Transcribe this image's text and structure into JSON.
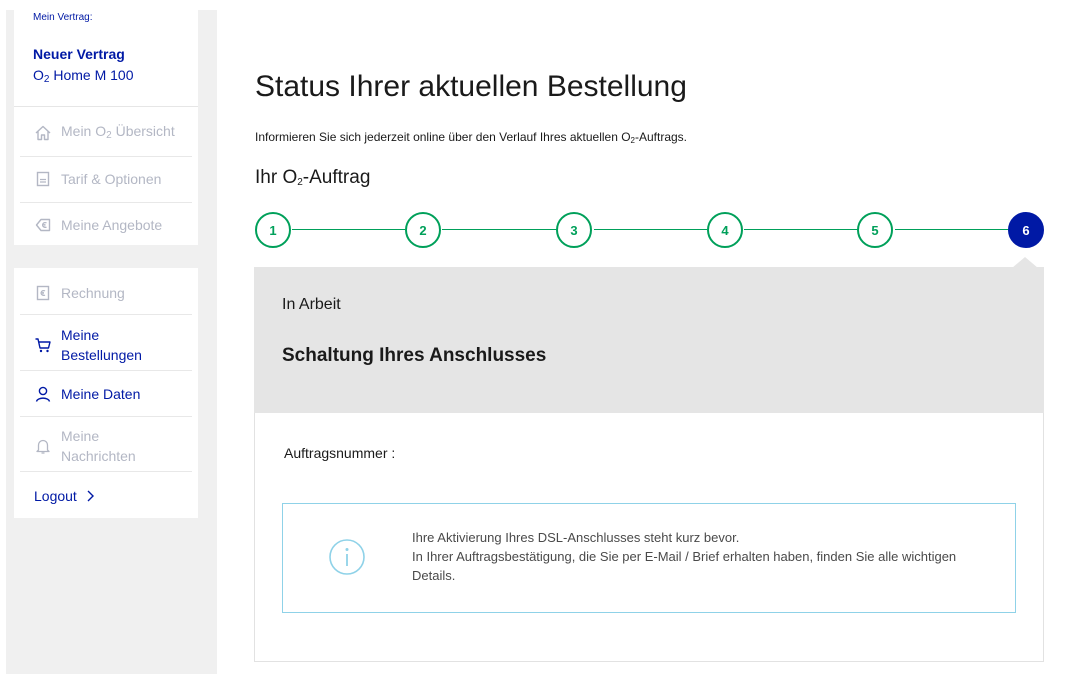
{
  "sidebar": {
    "contract_label": "Mein Vertrag:",
    "contract_name": "Neuer Vertrag",
    "contract_tariff_brand": "O",
    "contract_tariff_sub": "2",
    "contract_tariff_rest": " Home M 100",
    "nav_top": [
      {
        "label_pre": "Mein O",
        "label_sub": "2",
        "label_post": " Übersicht",
        "icon": "home-icon",
        "state": "disabled"
      },
      {
        "label": "Tarif & Optionen",
        "icon": "document-icon",
        "state": "disabled"
      },
      {
        "label": "Meine Angebote",
        "icon": "euro-tag-icon",
        "state": "disabled"
      }
    ],
    "nav_bottom": [
      {
        "label": "Rechnung",
        "icon": "invoice-icon",
        "state": "disabled"
      },
      {
        "label_line1": "Meine",
        "label_line2": "Bestellungen",
        "icon": "cart-icon",
        "state": "active"
      },
      {
        "label": "Meine Daten",
        "icon": "user-icon",
        "state": "active"
      },
      {
        "label_line1": "Meine",
        "label_line2": "Nachrichten",
        "icon": "bell-icon",
        "state": "disabled"
      }
    ],
    "logout_label": "Logout",
    "logout_icon": "chevron-right-icon"
  },
  "main": {
    "title": "Status Ihrer aktuellen Bestellung",
    "intro_pre": "Informieren Sie sich jederzeit online über den Verlauf Ihres aktuellen O",
    "intro_sub": "2",
    "intro_post": "-Auftrags.",
    "order_title_pre": "Ihr O",
    "order_title_sub": "2",
    "order_title_post": "-Auftrag",
    "steps": [
      "1",
      "2",
      "3",
      "4",
      "5",
      "6"
    ],
    "active_step": "6",
    "status": {
      "state": "In Arbeit",
      "title": "Schaltung Ihres Anschlusses"
    },
    "order_number_label": "Auftragsnummer :",
    "info": {
      "icon": "info-icon",
      "line1": "Ihre Aktivierung Ihres DSL-Anschlusses steht kurz bevor.",
      "line2": "In Ihrer Auftragsbestätigung, die Sie per E-Mail / Brief erhalten haben, finden Sie alle wichtigen Details."
    }
  },
  "colors": {
    "brand_blue": "#0019a5",
    "step_green": "#00a05a",
    "disabled_gray": "#b3b7c4",
    "info_border": "#8fd2e8"
  }
}
